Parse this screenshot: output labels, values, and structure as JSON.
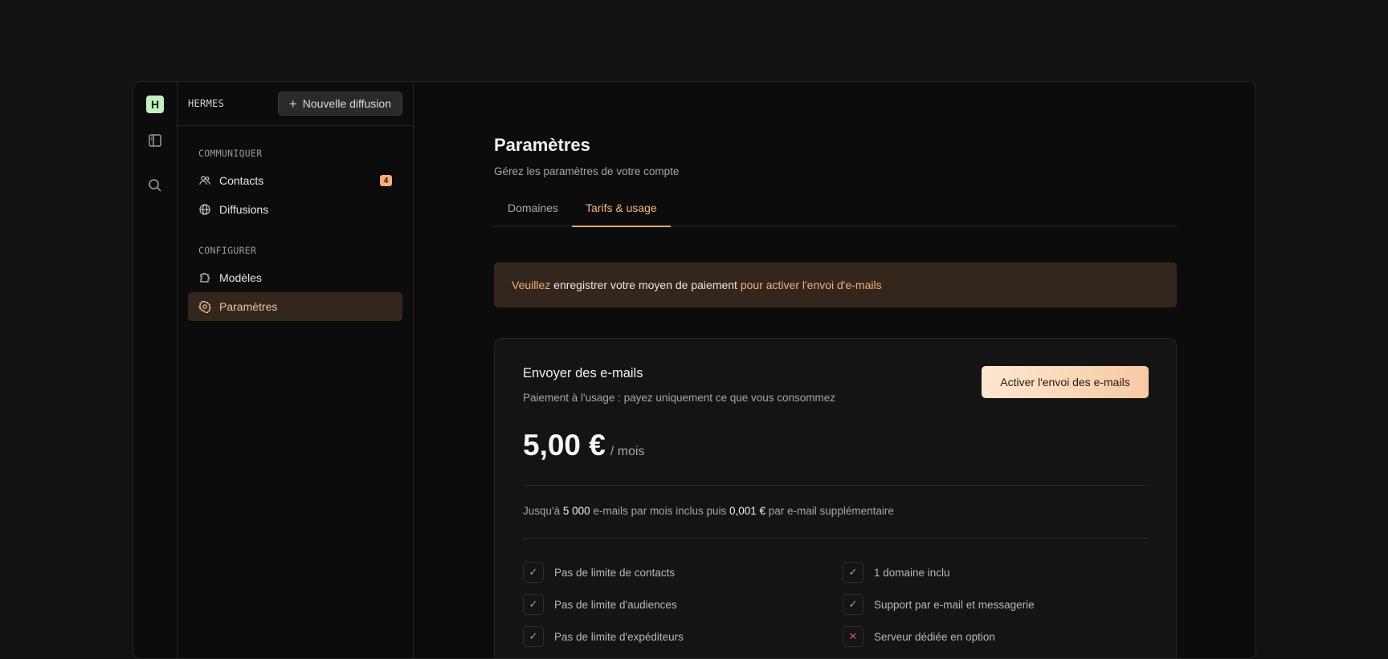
{
  "rail": {
    "logo_letter": "H"
  },
  "sidebar": {
    "brand": "HERMES",
    "new_button": "Nouvelle diffusion",
    "sections": [
      {
        "label": "COMMUNIQUER",
        "items": [
          {
            "label": "Contacts",
            "icon": "users-icon",
            "badge": "4"
          },
          {
            "label": "Diffusions",
            "icon": "globe-icon"
          }
        ]
      },
      {
        "label": "CONFIGURER",
        "items": [
          {
            "label": "Modèles",
            "icon": "puzzle-icon"
          },
          {
            "label": "Paramètres",
            "icon": "gear-icon",
            "active": true
          }
        ]
      }
    ]
  },
  "main": {
    "title": "Paramètres",
    "subtitle": "Gérez les paramètres de votre compte",
    "tabs": [
      {
        "label": "Domaines"
      },
      {
        "label": "Tarifs & usage",
        "active": true
      }
    ],
    "banner": {
      "part1": "Veuillez",
      "part2": " enregistrer votre moyen de paiement ",
      "part3": "pour activer l'envoi d'e-mails"
    },
    "card": {
      "title": "Envoyer des e-mails",
      "subtitle": "Paiement à l'usage : payez uniquement ce que vous consommez",
      "cta": "Activer l'envoi des e-mails",
      "price": "5,00 €",
      "price_unit": "/ mois",
      "usage": {
        "p1": "Jusqu'à ",
        "emails": "5 000",
        "p2": " e-mails par mois inclus puis ",
        "extra": "0,001 €",
        "p3": " par e-mail supplémentaire"
      },
      "features_left": [
        {
          "label": "Pas de limite de contacts",
          "included": true
        },
        {
          "label": "Pas de limite d'audiences",
          "included": true
        },
        {
          "label": "Pas de limite d'expéditeurs",
          "included": true
        }
      ],
      "features_right": [
        {
          "label": "1 domaine inclu",
          "included": true
        },
        {
          "label": "Support par e-mail et messagerie",
          "included": true
        },
        {
          "label": "Serveur dédiée en option",
          "included": false
        }
      ]
    }
  },
  "colors": {
    "accent": "#f2b07f",
    "active_bg": "#33271d",
    "logo_bg": "#c4f0c2",
    "check": "#5fcf6a",
    "cross": "#e05050"
  }
}
